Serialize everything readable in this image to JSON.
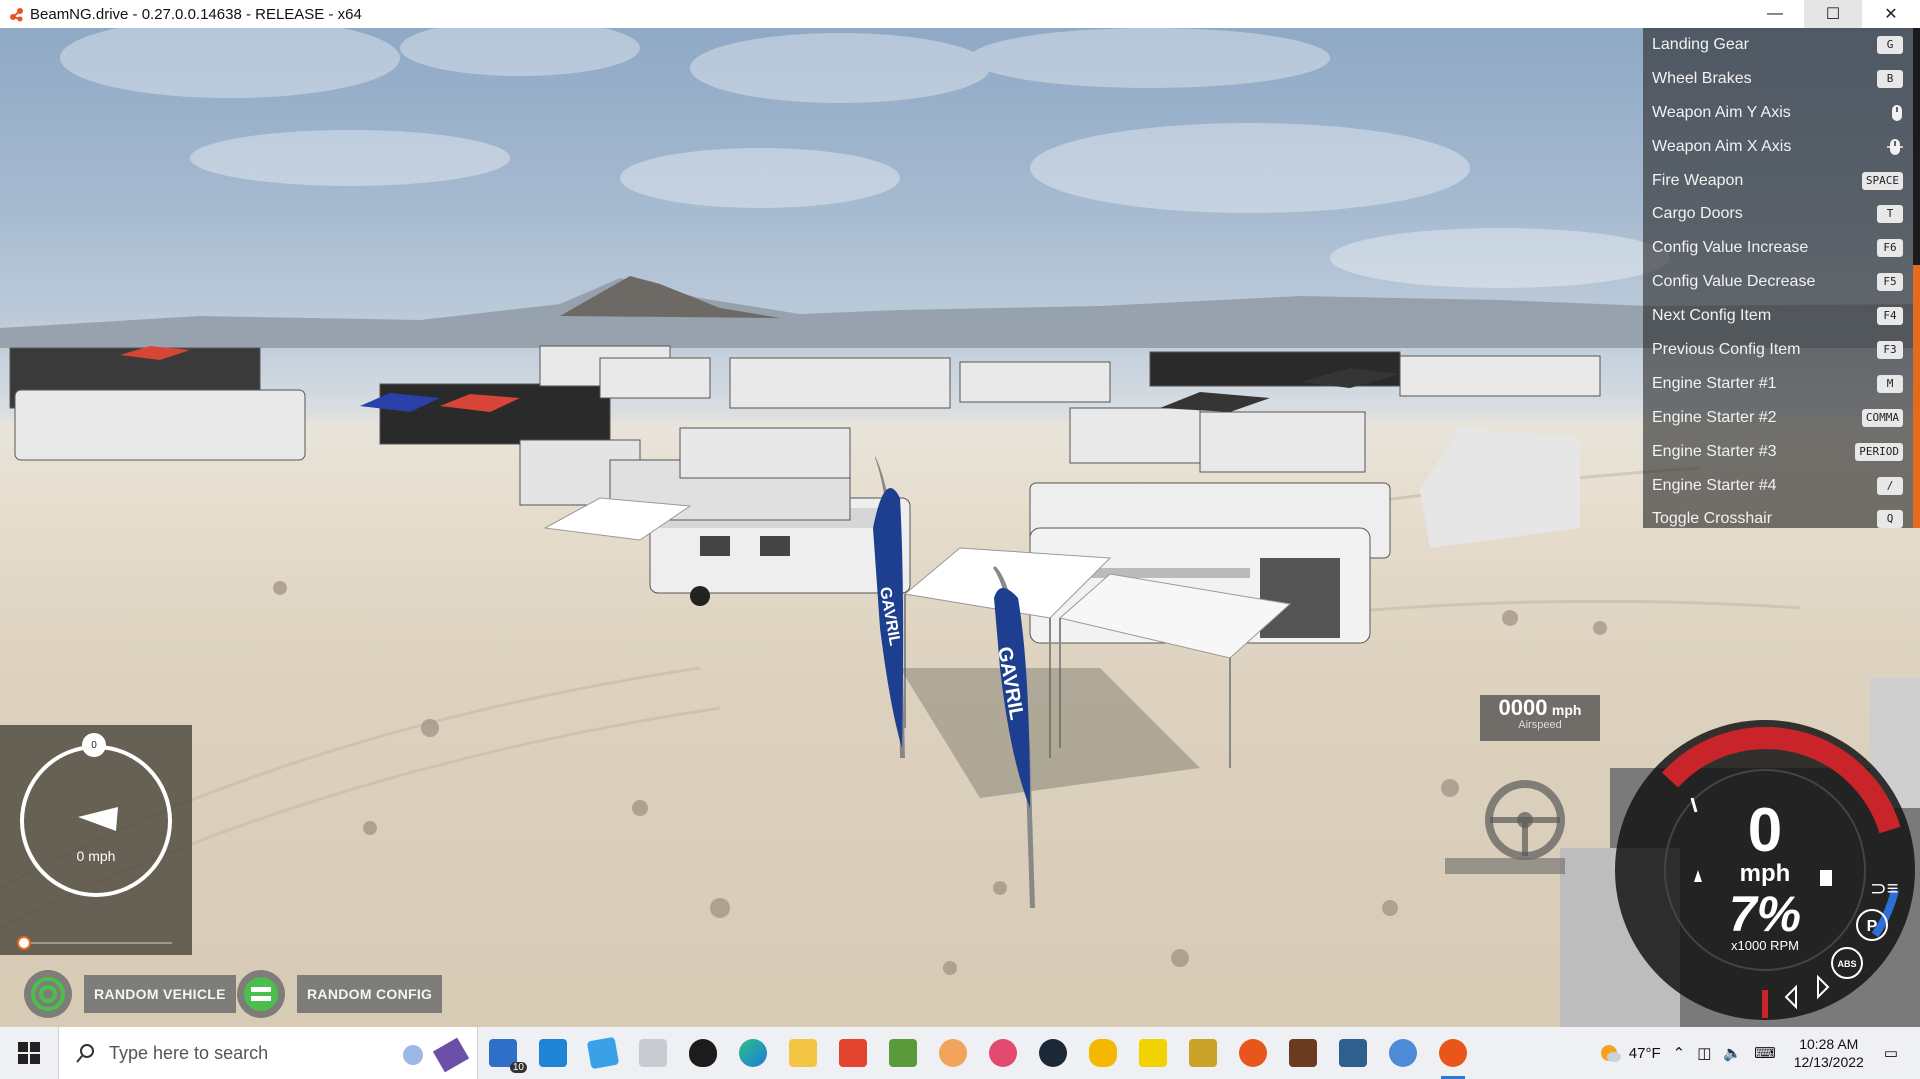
{
  "window": {
    "title": "BeamNG.drive - 0.27.0.0.14638 - RELEASE - x64",
    "min": "—",
    "max": "☐",
    "close": "✕"
  },
  "controls": [
    {
      "label": "Landing Gear",
      "key": "G"
    },
    {
      "label": "Wheel Brakes",
      "key": "B"
    },
    {
      "label": "Weapon Aim Y Axis",
      "key": ""
    },
    {
      "label": "Weapon Aim X Axis",
      "key": ""
    },
    {
      "label": "Fire Weapon",
      "key": "SPACE"
    },
    {
      "label": "Cargo Doors",
      "key": "T"
    },
    {
      "label": "Config Value Increase",
      "key": "F6"
    },
    {
      "label": "Config Value Decrease",
      "key": "F5"
    },
    {
      "label": "Next Config Item",
      "key": "F4"
    },
    {
      "label": "Previous Config Item",
      "key": "F3"
    },
    {
      "label": "Engine Starter #1",
      "key": "M"
    },
    {
      "label": "Engine Starter #2",
      "key": "COMMA"
    },
    {
      "label": "Engine Starter #3",
      "key": "PERIOD"
    },
    {
      "label": "Engine Starter #4",
      "key": "/"
    },
    {
      "label": "Toggle Crosshair",
      "key": "Q"
    }
  ],
  "flags": {
    "text": "GAVRIL"
  },
  "minimap": {
    "speed": "0 mph",
    "north": "0"
  },
  "buttons": {
    "random_vehicle": "RANDOM VEHICLE",
    "random_config": "RANDOM CONFIG"
  },
  "airspeed": {
    "value": "0000",
    "unit": "mph",
    "label": "Airspeed"
  },
  "gauge": {
    "speed": "0",
    "unit": "mph",
    "throttle": "7%",
    "rpm_label": "x1000 RPM",
    "abs": "ABS",
    "park": "P"
  },
  "taskbar": {
    "search_placeholder": "Type here to search",
    "mail_badge": "10",
    "weather": "47°F",
    "time": "10:28 AM",
    "date": "12/13/2022"
  },
  "colors": {
    "accent_orange": "#e56a1c",
    "gauge_red": "#c9242a",
    "gauge_blue": "#2d6fd6",
    "flag_blue": "#1e3f8f"
  }
}
